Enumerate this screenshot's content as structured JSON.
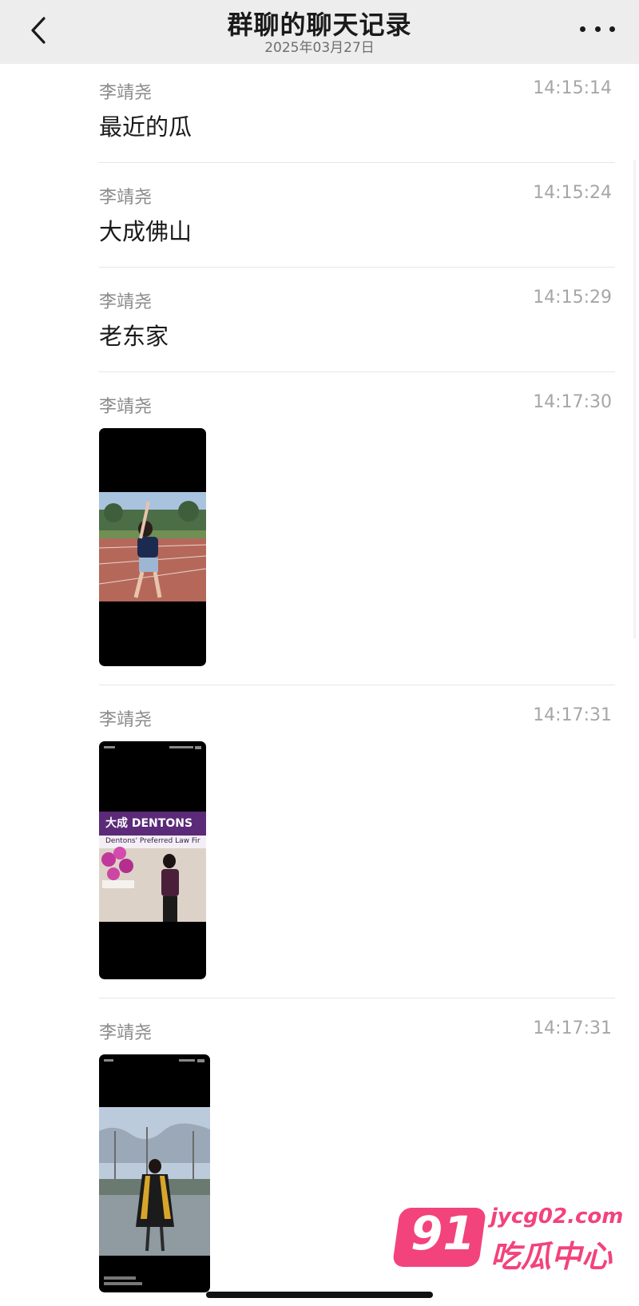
{
  "header": {
    "title": "群聊的聊天记录",
    "date": "2025年03月27日"
  },
  "messages": [
    {
      "sender": "李靖尧",
      "time": "14:15:14",
      "text": "最近的瓜"
    },
    {
      "sender": "李靖尧",
      "time": "14:15:24",
      "text": "大成佛山"
    },
    {
      "sender": "李靖尧",
      "time": "14:15:29",
      "text": "老东家"
    },
    {
      "sender": "李靖尧",
      "time": "14:17:30",
      "image": "photo-running-track"
    },
    {
      "sender": "李靖尧",
      "time": "14:17:31",
      "image": "photo-dentons-office",
      "image_text": "大成 DENTONS",
      "image_subtext": "Dentons' Preferred Law Fir"
    },
    {
      "sender": "李靖尧",
      "time": "14:17:31",
      "image": "photo-graduation"
    }
  ],
  "icons": {
    "back": "chevron-left-icon",
    "more": "more-dots-icon"
  },
  "watermark": {
    "badge": "91",
    "url": "jycg02.com",
    "name": "吃瓜中心"
  },
  "colors": {
    "header_bg": "#ededed",
    "accent": "#f2437c",
    "divider": "#e6e6e6"
  }
}
